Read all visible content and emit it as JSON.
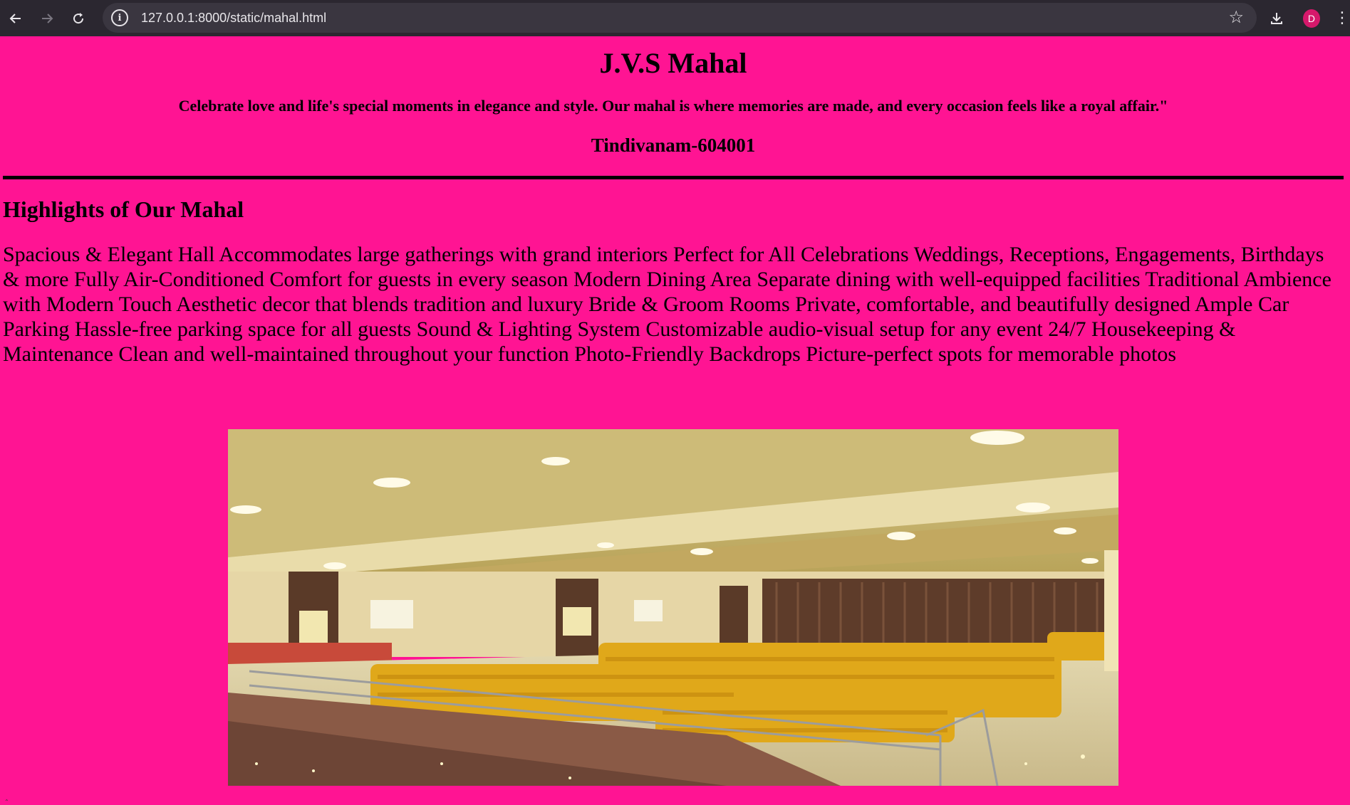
{
  "browser": {
    "url": "127.0.0.1:8000/static/mahal.html",
    "profile_initial": "D",
    "icons": {
      "back": "back-arrow-icon",
      "forward": "forward-arrow-icon",
      "reload": "reload-icon",
      "site_info": "info-icon",
      "bookmark": "star-icon",
      "downloads": "download-icon",
      "menu": "kebab-menu-icon"
    }
  },
  "page": {
    "title": "J.V.S Mahal",
    "tagline": "Celebrate love and life's special moments in elegance and style. Our mahal is where memories are made, and every occasion feels like a royal affair.\"",
    "location": "Tindivanam-604001",
    "highlights_heading": "Highlights of Our Mahal",
    "highlights_text": "Spacious & Elegant Hall Accommodates large gatherings with grand interiors Perfect for All Celebrations Weddings, Receptions, Engagements, Birthdays & more Fully Air-Conditioned Comfort for guests in every season Modern Dining Area Separate dining with well-equipped facilities Traditional Ambience with Modern Touch Aesthetic decor that blends tradition and luxury Bride & Groom Rooms Private, comfortable, and beautifully designed Ample Car Parking Hassle-free parking space for all guests Sound & Lighting System Customizable audio-visual setup for any event 24/7 Housekeeping & Maintenance Clean and well-maintained throughout your function Photo-Friendly Backdrops Picture-perfect spots for memorable photos",
    "background_color": "#ff1493"
  }
}
